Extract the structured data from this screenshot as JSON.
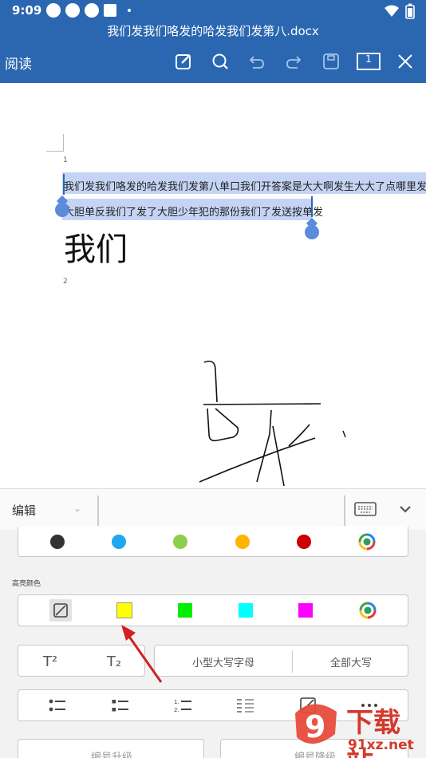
{
  "status_bar": {
    "time": "9:09"
  },
  "document": {
    "title": "我们发我们咯发的哈发我们发第八.docx",
    "page_marker_1": "1",
    "page_marker_2": "2",
    "line1": "我们发我们咯发的哈发我们发第八单口我们开答案是大大啊发生大大了点哪里发啦",
    "line2": "大胆单反我们了发了大胆少年犯的那份我们了发送按单发",
    "big_text": "我们"
  },
  "toolbar": {
    "read_label": "阅读",
    "page_count": "1"
  },
  "edit_bar": {
    "mode_label": "编辑"
  },
  "panel": {
    "highlight_label": "高亮颜色",
    "font_colors": [
      "#333333",
      "#1ea8f0",
      "#8ccf4c",
      "#ffb400",
      "#cc0000"
    ],
    "highlight_colors": [
      "#ffff00",
      "#00ee00",
      "#00ffff",
      "#ff00ff"
    ],
    "small_caps_label": "小型大写字母",
    "all_caps_label": "全部大写",
    "superscript_label": "T²",
    "subscript_label": "T₂",
    "bottom_left_label": "编号升级",
    "bottom_right_label": "编号降级"
  },
  "colors": {
    "accent": "#2b67b1",
    "selection": "#c5d4f5",
    "handle": "#5b8bd9"
  },
  "watermark": {
    "brand": "下载站",
    "domain": "91xz.net"
  }
}
